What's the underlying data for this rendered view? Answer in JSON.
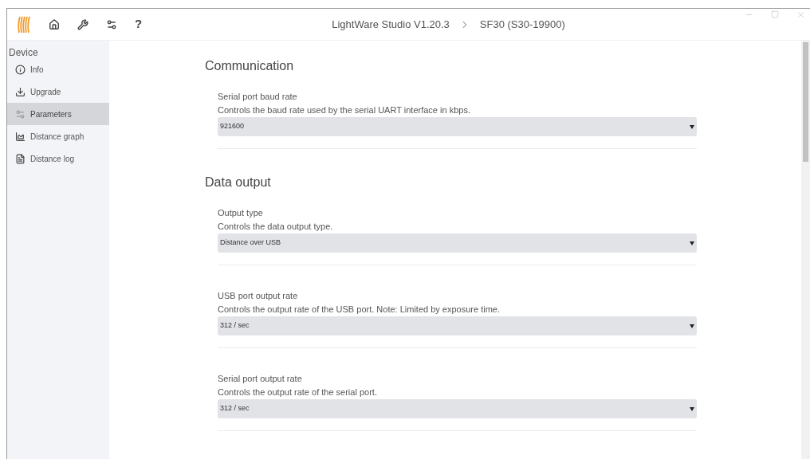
{
  "toolbar": {
    "help_label": "?"
  },
  "window": {
    "title": "LightWare Studio V1.20.3",
    "device": "SF30 (S30-19900)"
  },
  "sidebar": {
    "heading": "Device",
    "items": [
      {
        "label": "Info",
        "selected": false
      },
      {
        "label": "Upgrade",
        "selected": false
      },
      {
        "label": "Parameters",
        "selected": true
      },
      {
        "label": "Distance graph",
        "selected": false
      },
      {
        "label": "Distance log",
        "selected": false
      }
    ]
  },
  "sections": [
    {
      "title": "Communication",
      "fields": [
        {
          "label": "Serial port baud rate",
          "description": "Controls the baud rate used by the serial UART interface in kbps.",
          "value": "921600"
        }
      ]
    },
    {
      "title": "Data output",
      "fields": [
        {
          "label": "Output type",
          "description": "Controls the data output type.",
          "value": "Distance over USB"
        },
        {
          "label": "USB port output rate",
          "description": "Controls the output rate of the USB port. Note: Limited by exposure time.",
          "value": "312 / sec"
        },
        {
          "label": "Serial port output rate",
          "description": "Controls the output rate of the serial port.",
          "value": "312 / sec"
        }
      ]
    }
  ]
}
